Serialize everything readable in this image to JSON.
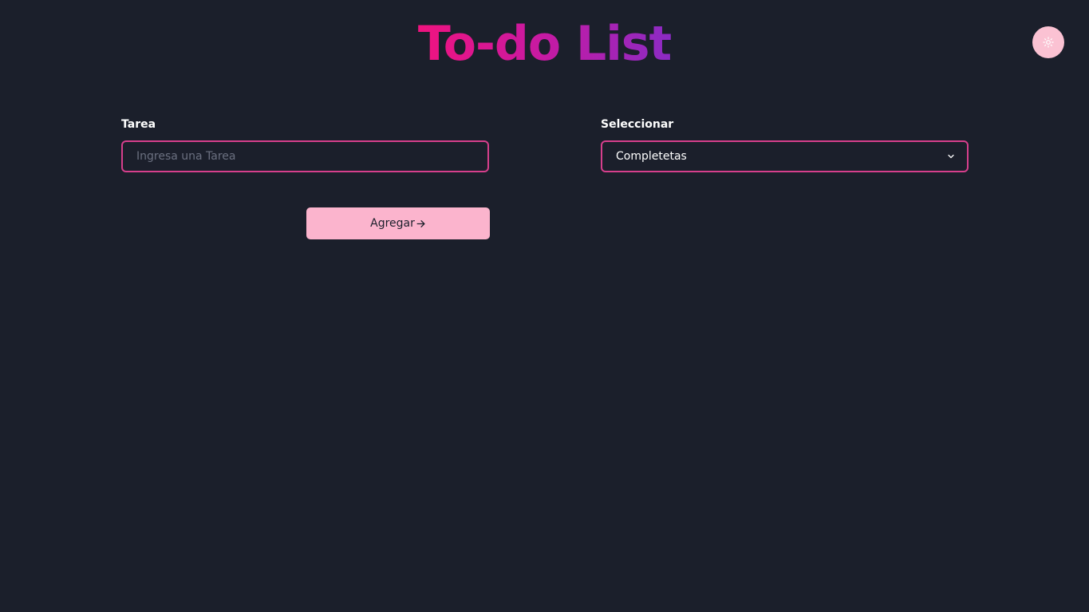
{
  "header": {
    "title": "To-do List",
    "theme_toggle_icon": "sun-icon"
  },
  "form": {
    "task": {
      "label": "Tarea",
      "placeholder": "Ingresa una Tarea",
      "value": ""
    },
    "filter": {
      "label": "Seleccionar",
      "selected": "Completetas",
      "icon": "chevron-down-icon"
    },
    "add_button": {
      "label": "Agregar",
      "icon": "arrow-right-icon"
    }
  },
  "colors": {
    "background": "#1b1f2b",
    "accent_border": "#d63f8c",
    "button": "#fbb4cd",
    "toggle": "#fbc2d3",
    "title_gradient": [
      "#f0137f",
      "#8b2bc4"
    ]
  }
}
